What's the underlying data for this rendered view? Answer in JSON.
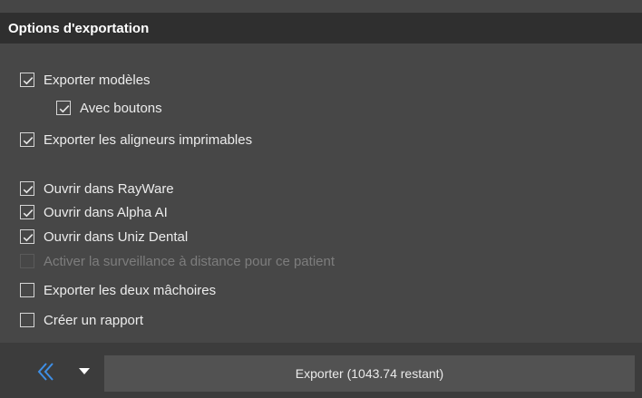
{
  "panel": {
    "title": "Options d'exportation"
  },
  "options": [
    {
      "label": "Exporter modèles",
      "checked": true,
      "disabled": false
    },
    {
      "label": "Avec boutons",
      "checked": true,
      "disabled": false
    },
    {
      "label": "Exporter les aligneurs imprimables",
      "checked": true,
      "disabled": false
    },
    {
      "label": "Ouvrir dans RayWare",
      "checked": true,
      "disabled": false
    },
    {
      "label": "Ouvrir dans Alpha AI",
      "checked": true,
      "disabled": false
    },
    {
      "label": "Ouvrir dans Uniz Dental",
      "checked": true,
      "disabled": false
    },
    {
      "label": "Activer la surveillance à distance pour ce patient",
      "checked": false,
      "disabled": true
    },
    {
      "label": "Exporter les deux mâchoires",
      "checked": false,
      "disabled": false
    },
    {
      "label": "Créer un rapport",
      "checked": false,
      "disabled": false
    }
  ],
  "footer": {
    "back_icon": "double-chevron-left-icon",
    "dropdown_icon": "caret-down-icon",
    "export_label": "Exporter (1043.74 restant)"
  },
  "colors": {
    "accent": "#3e8fe6",
    "background": "#474747",
    "header": "#2f2f2f"
  }
}
